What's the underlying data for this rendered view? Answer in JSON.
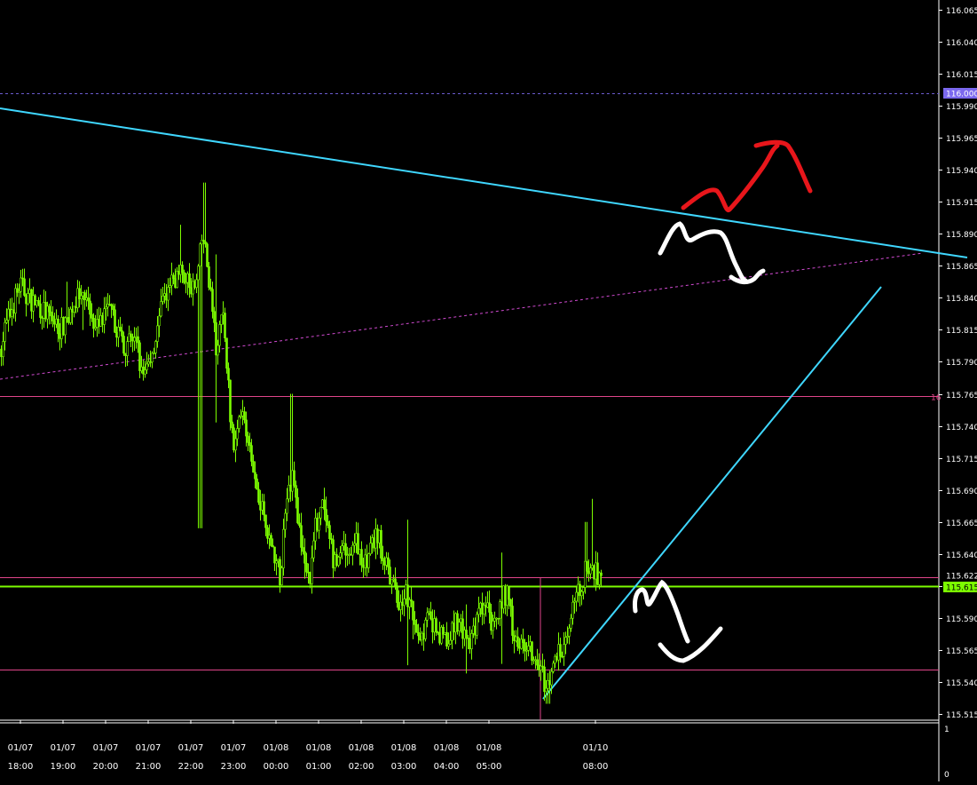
{
  "chart_data": {
    "type": "candlestick",
    "instrument_unit": "price",
    "y_range": [
      115.5,
      116.075
    ],
    "y_ticks": [
      "116.065",
      "116.040",
      "116.015",
      "115.990",
      "115.965",
      "115.940",
      "115.915",
      "115.890",
      "115.865",
      "115.840",
      "115.815",
      "115.790",
      "115.765",
      "115.740",
      "115.715",
      "115.690",
      "115.665",
      "115.640",
      "115.615",
      "115.590",
      "115.565",
      "115.540",
      "115.515"
    ],
    "price_tags": [
      {
        "label": "116.000",
        "value": 116.0,
        "color": "#7b68ee",
        "text_color": "#ffffff"
      },
      {
        "label": "115.622",
        "value": 115.622,
        "color": "#000000",
        "text_color": "#ffffff"
      },
      {
        "label": "115.615",
        "value": 115.615,
        "color": "#7cfc00",
        "text_color": "#000000"
      }
    ],
    "horizontal_lines": [
      {
        "value": 116.0,
        "color": "#6a5acd",
        "style": "dashed"
      },
      {
        "value": 115.763,
        "color": "#e0458a",
        "style": "solid",
        "label": "16"
      },
      {
        "value": 115.622,
        "color": "#e0458a",
        "style": "solid"
      },
      {
        "value": 115.615,
        "color": "#7cfc00",
        "style": "solid"
      },
      {
        "value": 115.55,
        "color": "#e0458a",
        "style": "solid"
      }
    ],
    "x_labels": [
      {
        "date": "01/07",
        "time": "18:00"
      },
      {
        "date": "01/07",
        "time": "19:00"
      },
      {
        "date": "01/07",
        "time": "20:00"
      },
      {
        "date": "01/07",
        "time": "21:00"
      },
      {
        "date": "01/07",
        "time": "22:00"
      },
      {
        "date": "01/07",
        "time": "23:00"
      },
      {
        "date": "01/08",
        "time": "00:00"
      },
      {
        "date": "01/08",
        "time": "01:00"
      },
      {
        "date": "01/08",
        "time": "02:00"
      },
      {
        "date": "01/08",
        "time": "03:00"
      },
      {
        "date": "01/08",
        "time": "04:00"
      },
      {
        "date": "01/08",
        "time": "05:00"
      },
      {
        "date": "01/10",
        "time": "08:00"
      }
    ],
    "price_path": [
      [
        0,
        115.8
      ],
      [
        5,
        115.815
      ],
      [
        12,
        115.83
      ],
      [
        22,
        115.85
      ],
      [
        32,
        115.84
      ],
      [
        42,
        115.835
      ],
      [
        55,
        115.825
      ],
      [
        68,
        115.815
      ],
      [
        78,
        115.83
      ],
      [
        88,
        115.84
      ],
      [
        100,
        115.83
      ],
      [
        110,
        115.82
      ],
      [
        122,
        115.83
      ],
      [
        132,
        115.815
      ],
      [
        142,
        115.8
      ],
      [
        152,
        115.81
      ],
      [
        160,
        115.78
      ],
      [
        168,
        115.79
      ],
      [
        175,
        115.81
      ],
      [
        183,
        115.835
      ],
      [
        192,
        115.85
      ],
      [
        200,
        115.86
      ],
      [
        210,
        115.855
      ],
      [
        220,
        115.845
      ],
      [
        228,
        115.89
      ],
      [
        236,
        115.85
      ],
      [
        243,
        115.8
      ],
      [
        250,
        115.83
      ],
      [
        256,
        115.78
      ],
      [
        262,
        115.72
      ],
      [
        270,
        115.76
      ],
      [
        278,
        115.73
      ],
      [
        286,
        115.7
      ],
      [
        294,
        115.68
      ],
      [
        300,
        115.66
      ],
      [
        308,
        115.64
      ],
      [
        316,
        115.62
      ],
      [
        322,
        115.69
      ],
      [
        330,
        115.7
      ],
      [
        336,
        115.66
      ],
      [
        342,
        115.64
      ],
      [
        348,
        115.62
      ],
      [
        355,
        115.66
      ],
      [
        362,
        115.68
      ],
      [
        370,
        115.65
      ],
      [
        378,
        115.63
      ],
      [
        386,
        115.65
      ],
      [
        394,
        115.64
      ],
      [
        402,
        115.65
      ],
      [
        410,
        115.63
      ],
      [
        418,
        115.645
      ],
      [
        426,
        115.655
      ],
      [
        434,
        115.63
      ],
      [
        442,
        115.615
      ],
      [
        450,
        115.6
      ],
      [
        458,
        115.61
      ],
      [
        466,
        115.59
      ],
      [
        474,
        115.575
      ],
      [
        482,
        115.59
      ],
      [
        490,
        115.58
      ],
      [
        498,
        115.575
      ],
      [
        506,
        115.57
      ],
      [
        514,
        115.59
      ],
      [
        522,
        115.58
      ],
      [
        530,
        115.57
      ],
      [
        538,
        115.59
      ],
      [
        546,
        115.6
      ],
      [
        554,
        115.585
      ],
      [
        562,
        115.6
      ],
      [
        570,
        115.61
      ],
      [
        578,
        115.58
      ],
      [
        586,
        115.565
      ],
      [
        594,
        115.575
      ],
      [
        602,
        115.56
      ],
      [
        610,
        115.545
      ],
      [
        618,
        115.535
      ],
      [
        626,
        115.56
      ],
      [
        634,
        115.57
      ],
      [
        642,
        115.59
      ],
      [
        650,
        115.605
      ],
      [
        658,
        115.625
      ],
      [
        666,
        115.63
      ],
      [
        674,
        115.622
      ],
      [
        678,
        115.622
      ]
    ]
  }
}
